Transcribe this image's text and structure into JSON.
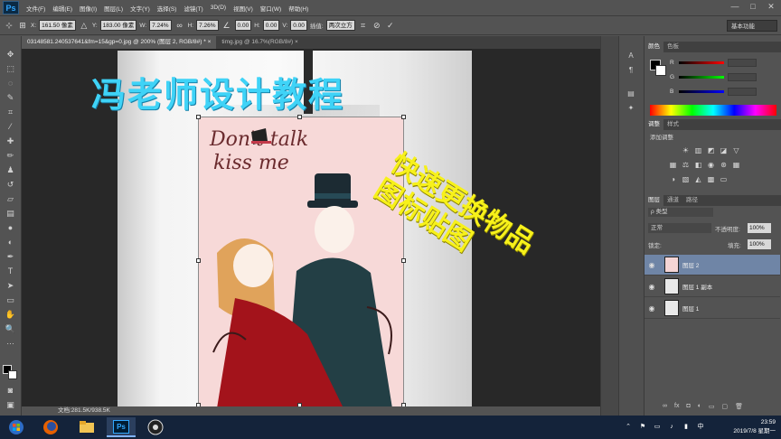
{
  "app": {
    "logo": "Ps"
  },
  "menu": [
    "文件(F)",
    "编辑(E)",
    "图像(I)",
    "图层(L)",
    "文字(Y)",
    "选择(S)",
    "滤镜(T)",
    "3D(D)",
    "视图(V)",
    "窗口(W)",
    "帮助(H)"
  ],
  "window_controls": {
    "minimize": "—",
    "maximize": "□",
    "close": "✕"
  },
  "options": {
    "x_label": "X:",
    "x_value": "161.50 像素",
    "y_label": "Y:",
    "y_value": "183.00 像素",
    "w_label": "W:",
    "w_value": "7.24%",
    "h_label": "H:",
    "h_value": "7.26%",
    "angle_value": "0.00",
    "hskew_label": "H:",
    "hskew_value": "0.00",
    "vskew_label": "V:",
    "vskew_value": "0.00",
    "interp_label": "插值:",
    "interp_value": "两次立方",
    "workspace": "基本功能"
  },
  "tabs": [
    {
      "label": "03148581.240537641&fm=15&gp=0.jpg @ 200% (图层 2, RGB/8#) *  ×"
    },
    {
      "label": "timg.jpg @ 16.7%(RGB/8#)  ×"
    }
  ],
  "canvas": {
    "watermark": "冯老师设计教程",
    "poster_text_line1": "Don't talk",
    "poster_text_line2": "kiss me",
    "overlay_line1": "快速更换物品",
    "overlay_line2": "图标贴图"
  },
  "status": {
    "doc": "文档:281.5K/938.5K"
  },
  "color_panel": {
    "tabs": [
      "颜色",
      "色板"
    ],
    "labels": [
      "R",
      "G",
      "B"
    ]
  },
  "adjust_panel": {
    "tabs": [
      "调整",
      "样式"
    ],
    "title": "添加调整"
  },
  "layers_panel": {
    "tabs": [
      "图层",
      "通道",
      "路径"
    ],
    "kind": "ρ 类型",
    "blend": "正常",
    "opacity_label": "不透明度:",
    "opacity_value": "100%",
    "lock_label": "锁定:",
    "fill_label": "填充:",
    "fill_value": "100%",
    "layers": [
      {
        "name": "图层 2",
        "selected": true
      },
      {
        "name": "图层 1 副本",
        "selected": false
      },
      {
        "name": "图层 1",
        "selected": false
      }
    ]
  },
  "taskbar": {
    "time": "23:59",
    "date": "2019/7/8 星期一",
    "ps_label": "Ps"
  }
}
